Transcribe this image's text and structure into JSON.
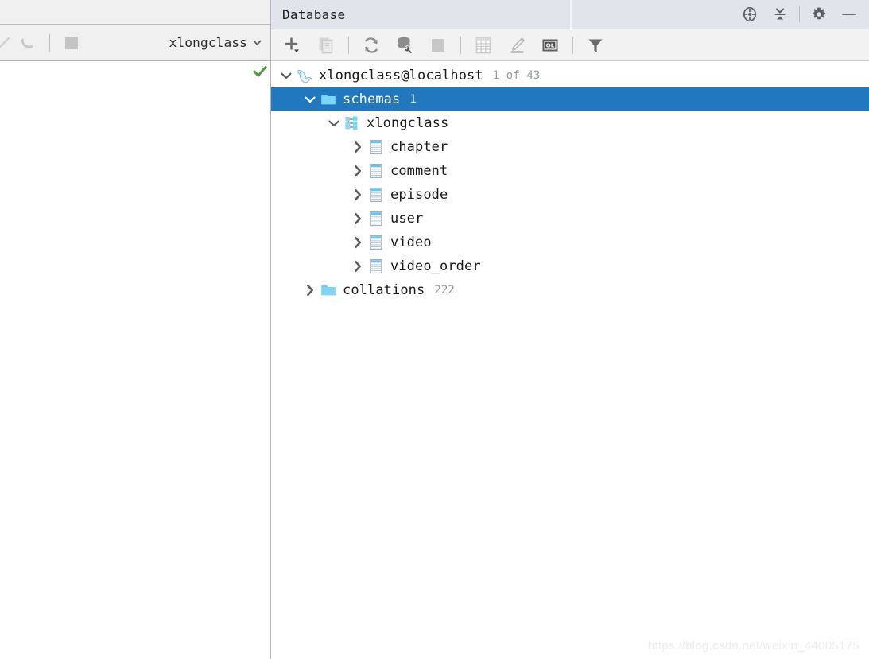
{
  "left_panel": {
    "toolbar": {
      "buttons": [
        {
          "name": "apply-check-button",
          "icon": "check-icon",
          "label": "",
          "enabled": false
        },
        {
          "name": "revert-button",
          "icon": "undo-arrow-icon",
          "label": "",
          "enabled": false
        },
        {
          "name": "stop-button",
          "icon": "stop-square-icon",
          "label": "",
          "enabled": false
        }
      ],
      "datasource_combo": {
        "value": "xlongclass",
        "chevron": "chevron-down-icon"
      }
    },
    "status_check": "green-check-icon"
  },
  "db_panel": {
    "header": {
      "title": "Database",
      "actions": [
        {
          "name": "scroll-from-source-button",
          "icon": "crosshair-target-icon"
        },
        {
          "name": "collapse-all-button",
          "icon": "collapse-all-icon"
        },
        {
          "name": "settings-button",
          "icon": "gear-icon"
        },
        {
          "name": "hide-button",
          "icon": "minimize-icon"
        }
      ]
    },
    "toolbar": {
      "buttons": [
        {
          "name": "add-button",
          "icon": "plus-dropdown-icon",
          "enabled": true
        },
        {
          "name": "duplicate-button",
          "icon": "copy-icon",
          "enabled": false
        },
        {
          "name": "refresh-button",
          "icon": "refresh-icon",
          "enabled": true
        },
        {
          "name": "modify-datasource-button",
          "icon": "database-wrench-icon",
          "enabled": true
        },
        {
          "name": "stop-button",
          "icon": "stop-square-icon",
          "enabled": false
        },
        {
          "name": "data-editor-button",
          "icon": "table-grid-icon",
          "enabled": false
        },
        {
          "name": "modify-object-button",
          "icon": "pencil-edit-icon",
          "enabled": false
        },
        {
          "name": "query-console-button",
          "icon": "ql-console-icon",
          "enabled": true
        },
        {
          "name": "filter-button",
          "icon": "funnel-filter-icon",
          "enabled": true
        }
      ]
    },
    "tree": [
      {
        "label": "xlongclass@localhost",
        "count": "1 of 43",
        "icon": "mysql-dolphin-icon",
        "indent": 0,
        "twisty": "expanded",
        "selected": false,
        "name": "tree-node-datasource"
      },
      {
        "label": "schemas",
        "count": "1",
        "icon": "folder-icon",
        "indent": 1,
        "twisty": "expanded",
        "selected": true,
        "name": "tree-node-schemas"
      },
      {
        "label": "xlongclass",
        "count": "",
        "icon": "schema-icon",
        "indent": 2,
        "twisty": "expanded",
        "selected": false,
        "name": "tree-node-schema-xlongclass"
      },
      {
        "label": "chapter",
        "count": "",
        "icon": "table-icon",
        "indent": 3,
        "twisty": "collapsed",
        "selected": false,
        "name": "tree-node-table-chapter"
      },
      {
        "label": "comment",
        "count": "",
        "icon": "table-icon",
        "indent": 3,
        "twisty": "collapsed",
        "selected": false,
        "name": "tree-node-table-comment"
      },
      {
        "label": "episode",
        "count": "",
        "icon": "table-icon",
        "indent": 3,
        "twisty": "collapsed",
        "selected": false,
        "name": "tree-node-table-episode"
      },
      {
        "label": "user",
        "count": "",
        "icon": "table-icon",
        "indent": 3,
        "twisty": "collapsed",
        "selected": false,
        "name": "tree-node-table-user"
      },
      {
        "label": "video",
        "count": "",
        "icon": "table-icon",
        "indent": 3,
        "twisty": "collapsed",
        "selected": false,
        "name": "tree-node-table-video"
      },
      {
        "label": "video_order",
        "count": "",
        "icon": "table-icon",
        "indent": 3,
        "twisty": "collapsed",
        "selected": false,
        "name": "tree-node-table-video-order"
      },
      {
        "label": "collations",
        "count": "222",
        "icon": "folder-icon",
        "indent": 1,
        "twisty": "collapsed",
        "selected": false,
        "name": "tree-node-collations"
      }
    ]
  },
  "watermark": "https://blog.csdn.net/weixin_44005175",
  "colors": {
    "selection_blue": "#2278bf",
    "header_bg": "#e1e4eb",
    "toolbar_bg": "#f2f2f2",
    "folder_cyan": "#6dcff6",
    "icon_grey": "#7f7f7f",
    "icon_disabled": "#c8c8c8",
    "green_check": "#4d9e3f"
  }
}
